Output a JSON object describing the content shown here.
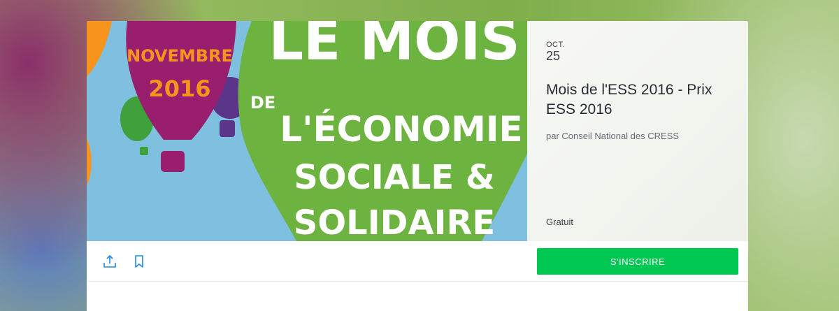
{
  "event": {
    "banner_text": {
      "month_line": "NOVEMBRE",
      "year_line": "2016",
      "headline_1": "LE MOIS",
      "headline_2": "DE",
      "headline_3": "L'ÉCONOMIE",
      "headline_4": "SOCIALE &",
      "headline_5": "SOLIDAIRE"
    },
    "date_month": "OCT.",
    "date_day": "25",
    "title": "Mois de l'ESS 2016 - Prix ESS 2016",
    "organizer": "par Conseil National des CRESS",
    "price": "Gratuit"
  },
  "actions": {
    "share_icon": "share-icon",
    "bookmark_icon": "bookmark-icon",
    "register_label": "S'INSCRIRE"
  },
  "colors": {
    "accent_green": "#00c853",
    "icon_blue": "#1e88e5",
    "banner_sky": "#7fbfdf",
    "banner_green": "#6cb33f",
    "banner_magenta": "#9a1e6e",
    "banner_orange": "#f7941d"
  }
}
